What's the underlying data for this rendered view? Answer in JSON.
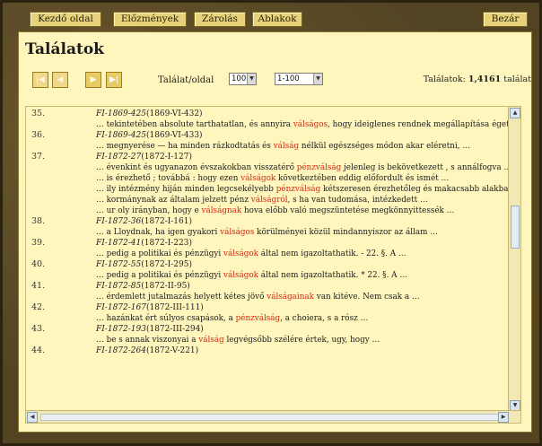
{
  "menu": {
    "home": "Kezdő oldal",
    "history": "Előzmények",
    "lock": "Zárolás",
    "windows": "Ablakok",
    "close": "Bezár"
  },
  "page_title": "Találatok",
  "pager": {
    "first_icon": "first-page-icon",
    "prev_icon": "prev-page-icon",
    "next_icon": "next-page-icon",
    "last_icon": "last-page-icon",
    "per_page_label": "Találat/oldal",
    "per_page_value": "100",
    "range_value": "1-100"
  },
  "result_count": {
    "label": "Találatok:",
    "value": "1,4161",
    "unit": "találat"
  },
  "colors": {
    "highlight": "#d22a14",
    "panel": "#fff6bd",
    "button": "#e6d27a"
  },
  "results": [
    {
      "num": "35.",
      "ref": "FI-1869-425",
      "date": "(1869-VI-432)",
      "lines": [
        [
          "… tekintetében absolute tarthatatlan, és annyira ",
          "válságos",
          ", hogy ideiglenes rendnek megállapítása égető"
        ]
      ]
    },
    {
      "num": "36.",
      "ref": "FI-1869-425",
      "date": "(1869-VI-433)",
      "lines": [
        [
          "… megnyerése — ha minden rázkodtatás és ",
          "válság",
          " nélkül egészséges módon akar eléretni, …"
        ]
      ]
    },
    {
      "num": "37.",
      "ref": "FI-1872-27",
      "date": "(1872-I-127)",
      "lines": [
        [
          "… évenkint és ugyanazon évszakokban visszatérő ",
          "pénzválság",
          " jelenleg is bekövetkezett , s annálfogva …"
        ],
        [
          "… is érezhető ; továbbá : hogy ezen ",
          "válságok",
          " következtében eddig előfordult és ismét …"
        ],
        [
          "… ily intézmény hiján minden legcsekélyebb ",
          "pénzválság",
          " kétszeresen érezhetőleg és makacsabb alakban"
        ],
        [
          "… kormánynak az általam jelzett pénz ",
          "válságról",
          ", s ha van tudomása, intézkedett …"
        ],
        [
          "… ur oly irányban, hogy e ",
          "válságnak",
          " hova előbb való megszüntetése megkönnyittessék …"
        ]
      ]
    },
    {
      "num": "38.",
      "ref": "FI-1872-36",
      "date": "(1872-I-161)",
      "lines": [
        [
          "… a Lloydnak, ha igen gyakori ",
          "válságos",
          " körülményei közül mindannyiszor az állam …"
        ]
      ]
    },
    {
      "num": "39.",
      "ref": "FI-1872-41",
      "date": "(1872-I-223)",
      "lines": [
        [
          "… pedig a politikai és pénzügyi ",
          "válságok",
          " által nem igazoltathatik. - 22. §. A …"
        ]
      ]
    },
    {
      "num": "40.",
      "ref": "FI-1872-55",
      "date": "(1872-I-295)",
      "lines": [
        [
          "… pedig a politikai és pénzügyi ",
          "válságok",
          " által nem igazoltathatik. * 22. §. A …"
        ]
      ]
    },
    {
      "num": "41.",
      "ref": "FI-1872-85",
      "date": "(1872-II-95)",
      "lines": [
        [
          "… érdemlett jutalmazás helyett kétes jövő ",
          "válságainak",
          " van kitéve. Nem csak a …"
        ]
      ]
    },
    {
      "num": "42.",
      "ref": "FI-1872-167",
      "date": "(1872-III-111)",
      "lines": [
        [
          "… hazánkat ért súlyos csapások, a ",
          "pénzválság",
          ", a choiera, s a rósz …"
        ]
      ]
    },
    {
      "num": "43.",
      "ref": "FI-1872-193",
      "date": "(1872-III-294)",
      "lines": [
        [
          "… be s annak viszonyai a ",
          "válság",
          " legvégsőbb szélére értek, ugy, hogy …"
        ]
      ]
    },
    {
      "num": "44.",
      "ref": "FI-1872-264",
      "date": "(1872-V-221)",
      "lines": []
    }
  ]
}
